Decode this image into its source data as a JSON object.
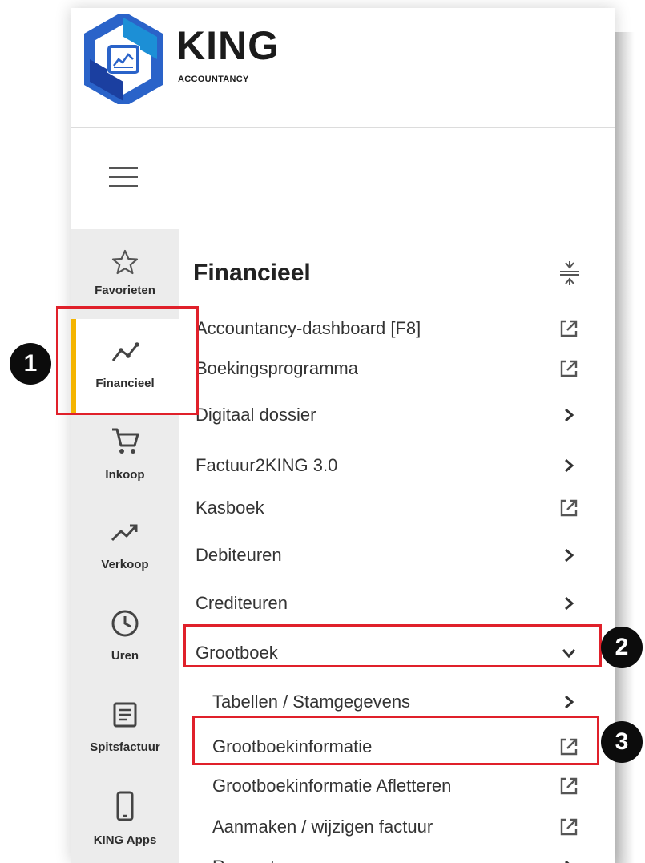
{
  "logo": {
    "name": "KING",
    "tagline": "ACCOUNTANCY"
  },
  "rail": {
    "items": [
      {
        "label": "Favorieten",
        "icon": "star-icon"
      },
      {
        "label": "Financieel",
        "icon": "trend-icon",
        "active": true
      },
      {
        "label": "Inkoop",
        "icon": "cart-icon"
      },
      {
        "label": "Verkoop",
        "icon": "trend-up-icon"
      },
      {
        "label": "Uren",
        "icon": "clock-icon"
      },
      {
        "label": "Spitsfactuur",
        "icon": "document-icon"
      },
      {
        "label": "KING Apps",
        "icon": "phone-icon"
      }
    ]
  },
  "menu": {
    "title": "Financieel",
    "items": [
      {
        "label": "Accountancy-dashboard [F8]",
        "icon": "external-link-icon"
      },
      {
        "label": "Boekingsprogramma",
        "icon": "external-link-icon"
      },
      {
        "label": "Digitaal dossier",
        "icon": "chevron-right-icon"
      },
      {
        "label": "Factuur2KING 3.0",
        "icon": "chevron-right-icon"
      },
      {
        "label": "Kasboek",
        "icon": "external-link-icon"
      },
      {
        "label": "Debiteuren",
        "icon": "chevron-right-icon"
      },
      {
        "label": "Crediteuren",
        "icon": "chevron-right-icon"
      },
      {
        "label": "Grootboek",
        "icon": "chevron-down-icon"
      },
      {
        "label": "Tabellen / Stamgegevens",
        "icon": "chevron-right-icon"
      },
      {
        "label": "Grootboekinformatie",
        "icon": "external-link-icon"
      },
      {
        "label": "Grootboekinformatie Afletteren",
        "icon": "external-link-icon"
      },
      {
        "label": "Aanmaken / wijzigen factuur",
        "icon": "external-link-icon"
      },
      {
        "label": "Rapporten",
        "icon": "chevron-right-icon"
      }
    ]
  },
  "callouts": [
    "1",
    "2",
    "3"
  ],
  "colors": {
    "accent": "#f4b400",
    "highlight": "#e0202a",
    "logo_blue": "#2a63c9"
  }
}
